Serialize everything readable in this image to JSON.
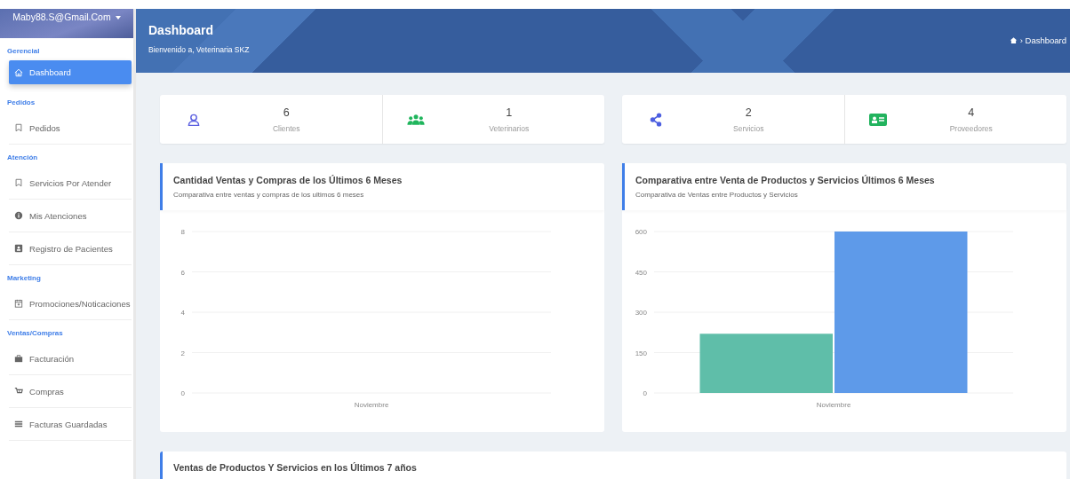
{
  "sidebar": {
    "user": "Maby88.S@Gmail.Com",
    "sections": [
      {
        "label": "Gerencial",
        "items": [
          {
            "label": "Dashboard",
            "selected": true
          }
        ]
      },
      {
        "label": "Pedidos",
        "items": [
          {
            "label": "Pedidos",
            "selected": false
          }
        ]
      },
      {
        "label": "Atención",
        "items": [
          {
            "label": "Servicios Por Atender",
            "selected": false
          },
          {
            "label": "Mis Atenciones",
            "selected": false
          },
          {
            "label": "Registro de Pacientes",
            "selected": false
          }
        ]
      },
      {
        "label": "Marketing",
        "items": [
          {
            "label": "Promociones/Noticaciones",
            "selected": false
          }
        ]
      },
      {
        "label": "Ventas/Compras",
        "items": [
          {
            "label": "Facturación",
            "selected": false
          },
          {
            "label": "Compras",
            "selected": false
          },
          {
            "label": "Facturas Guardadas",
            "selected": false
          }
        ]
      }
    ]
  },
  "header": {
    "title": "Dashboard",
    "subtitle": "Bienvenido a, Veterinaria SKZ",
    "breadcrumb": "› Dashboard"
  },
  "stats": [
    {
      "value": "6",
      "label": "Clientes"
    },
    {
      "value": "1",
      "label": "Veterinarios"
    },
    {
      "value": "2",
      "label": "Servicios"
    },
    {
      "value": "4",
      "label": "Proveedores"
    }
  ],
  "charts": [
    {
      "title": "Cantidad Ventas y Compras de los Últimos 6 Meses",
      "subtitle": "Comparativa entre ventas y compras de los ultimos 6 meses",
      "chart_data": {
        "type": "bar",
        "categories": [
          "Noviembre"
        ],
        "ylim": [
          0,
          8
        ],
        "yticks": [
          0,
          2,
          4,
          6,
          8
        ],
        "grid": true
      }
    },
    {
      "title": "Comparativa entre Venta de Productos y Servicios Últimos 6 Meses",
      "subtitle": "Comparativa de Ventas entre Productos y Servicios",
      "chart_data": {
        "type": "bar",
        "categories": [
          "Noviembre"
        ],
        "ylim": [
          0,
          600
        ],
        "yticks": [
          0,
          150,
          300,
          450,
          600
        ],
        "grid": true,
        "series": [
          {
            "color": "#5fbea9",
            "values": [
              220
            ]
          },
          {
            "color": "#5e9ae9",
            "values": [
              600
            ]
          }
        ]
      }
    }
  ],
  "bottom_card": {
    "title": "Ventas de Productos Y Servicios en los Últimos 7 años"
  }
}
